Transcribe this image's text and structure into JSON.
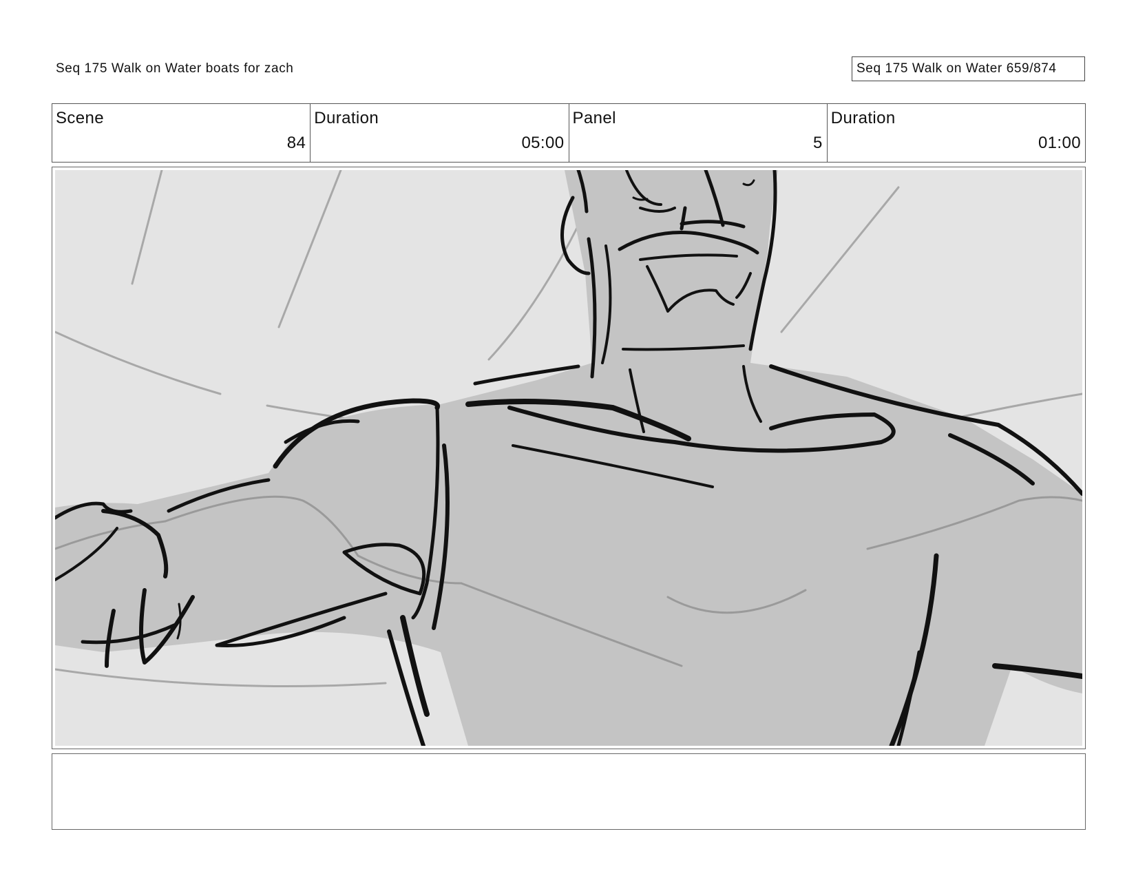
{
  "header": {
    "title": "Seq 175 Walk on Water  boats for zach",
    "page_ref": "Seq 175 Walk on Water 659/874"
  },
  "info": {
    "scene_label": "Scene",
    "scene_value": "84",
    "duration_label": "Duration",
    "duration_value": "05:00",
    "panel_label": "Panel",
    "panel_value": "5",
    "panel_duration_label": "Duration",
    "panel_duration_value": "01:00"
  },
  "notes": "",
  "colors": {
    "sky": "#e4e4e4",
    "body_tone": "#c4c4c4",
    "ink": "#111111",
    "sketch_lines": "#a8a8a8"
  }
}
